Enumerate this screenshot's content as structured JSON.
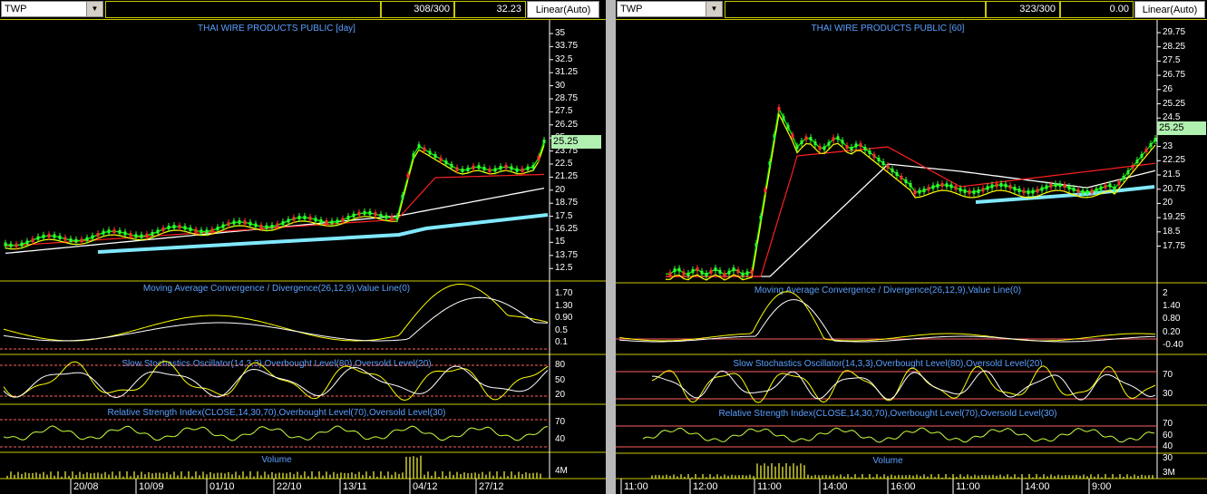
{
  "left": {
    "symbol": "TWP",
    "bars_count": "308/300",
    "value": "32.23",
    "scale_mode": "Linear(Auto)",
    "title": "THAI WIRE PRODUCTS PUBLIC [day]",
    "price_axis": [
      "35",
      "33.75",
      "32.5",
      "31.25",
      "30",
      "28.75",
      "27.5",
      "26.25",
      "25",
      "23.75",
      "22.5",
      "21.25",
      "20",
      "18.75",
      "17.5",
      "16.25",
      "15",
      "13.75",
      "12.5"
    ],
    "last_price": "25.25",
    "macd_title": "Moving Average Convergence / Divergence(26,12,9),Value Line(0)",
    "macd_axis": [
      "1.70",
      "1.30",
      "0.90",
      "0.5",
      "0.1"
    ],
    "stoch_title": "Slow Stochastics Oscillator(14,3,3),Overbought Level(80),Oversold Level(20)",
    "stoch_axis": [
      "80",
      "50",
      "20"
    ],
    "rsi_title": "Relative Strength Index(CLOSE,14,30,70),Overbought Level(70),Oversold Level(30)",
    "rsi_axis": [
      "70",
      "40"
    ],
    "volume_title": "Volume",
    "volume_axis": [
      "4M"
    ],
    "dates": [
      "20/08",
      "10/09",
      "01/10",
      "22/10",
      "13/11",
      "04/12",
      "27/12"
    ]
  },
  "right": {
    "symbol": "TWP",
    "bars_count": "323/300",
    "value": "0.00",
    "scale_mode": "Linear(Auto)",
    "title": "THAI WIRE PRODUCTS PUBLIC [60]",
    "price_axis": [
      "29.75",
      "28.25",
      "27.5",
      "26.75",
      "26",
      "25.25",
      "24.5",
      "23.75",
      "23",
      "22.25",
      "21.5",
      "20.75",
      "20",
      "19.25",
      "18.5",
      "17.75"
    ],
    "last_price": "25.25",
    "macd_title": "Moving Average Convergence / Divergence(26,12,9),Value Line(0)",
    "macd_axis": [
      "2",
      "1.40",
      "0.80",
      "0.20",
      "-0.40"
    ],
    "stoch_title": "Slow Stochastics Oscillator(14,3,3),Overbought Level(80),Oversold Level(20)",
    "stoch_axis": [
      "70",
      "30"
    ],
    "rsi_title": "Relative Strength Index(CLOSE,14,30,70),Overbought Level(70),Oversold Level(30)",
    "rsi_axis": [
      "70",
      "60",
      "40",
      "30"
    ],
    "volume_title": "Volume",
    "volume_axis": [
      "3M"
    ],
    "dates": [
      "11:00",
      "12:00",
      "11:00",
      "14:00",
      "16:00",
      "11:00",
      "14:00",
      "9:00"
    ]
  },
  "colors": {
    "price_line": "#00ff00",
    "ma_fast": "#ffff00",
    "ma_slow": "#ff2020",
    "ma_long": "#ffffff",
    "trend": "#80e8ff",
    "level_line": "#ff6060",
    "title": "#5aa0ff",
    "separator": "#c8c800"
  }
}
